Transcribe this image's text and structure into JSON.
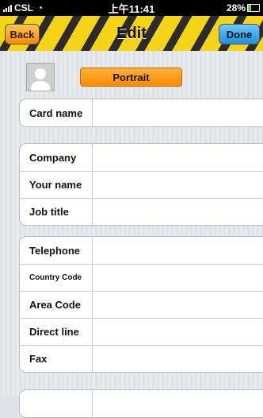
{
  "status_bar": {
    "carrier": "CSL",
    "time": "上午11:41",
    "battery": "28%"
  },
  "navbar": {
    "back_label": "Back",
    "title": "Edit",
    "done_label": "Done"
  },
  "portrait_button": {
    "label": "Portrait"
  },
  "groups": [
    {
      "rows": [
        {
          "label": "Card name",
          "value": ""
        }
      ]
    },
    {
      "rows": [
        {
          "label": "Company",
          "value": ""
        },
        {
          "label": "Your name",
          "value": ""
        },
        {
          "label": "Job title",
          "value": ""
        }
      ]
    },
    {
      "rows": [
        {
          "label": "Telephone",
          "value": ""
        },
        {
          "label": "Country Code",
          "value": ""
        },
        {
          "label": "Area Code",
          "value": ""
        },
        {
          "label": "Direct line",
          "value": ""
        },
        {
          "label": "Fax",
          "value": ""
        }
      ]
    },
    {
      "rows": [
        {
          "label": "",
          "value": ""
        }
      ]
    }
  ],
  "colors": {
    "nav_stripe_yellow": "#f5d316",
    "nav_stripe_dark": "#2b2b2b",
    "back_button": "#ff8a00",
    "done_button": "#1b8fe6",
    "portrait_button": "#ff8a00"
  }
}
